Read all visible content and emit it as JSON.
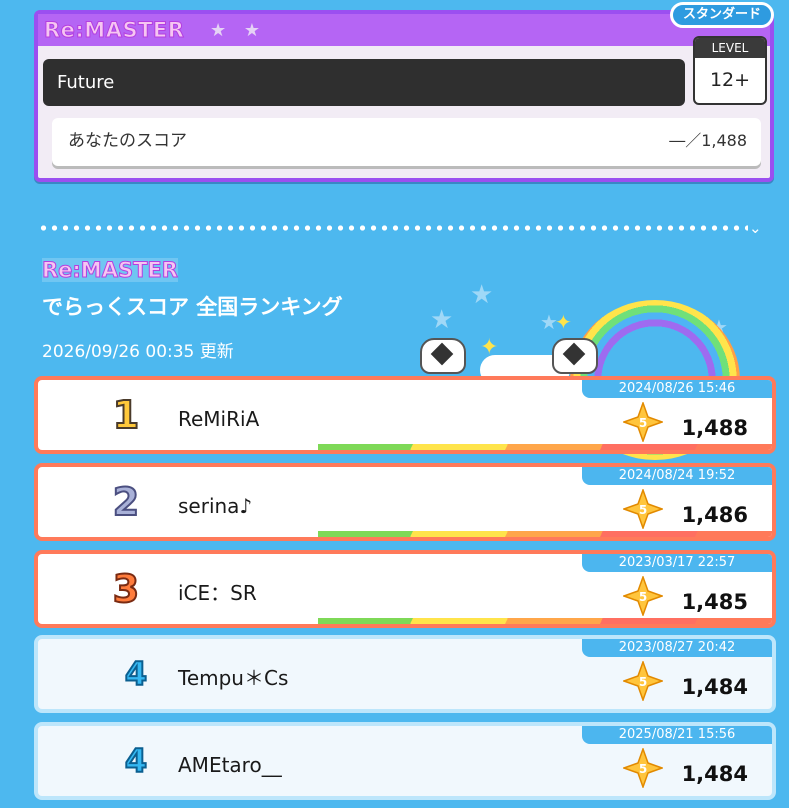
{
  "song": {
    "difficulty": "Re:MASTER",
    "stars": "★ ★",
    "chart_type": "スタンダード",
    "title": "Future",
    "level_label": "LEVEL",
    "level": "12+",
    "your_score_label": "あなたのスコア",
    "your_score": "―／1,488"
  },
  "ranking": {
    "difficulty": "Re:MASTER",
    "title": "でらっくスコア 全国ランキング",
    "updated": "2026/09/26 00:35 更新",
    "entries": [
      {
        "rank": "1",
        "player": "ReMiRiA",
        "date": "2024/08/26 15:46",
        "badge": "5",
        "score": "1,488"
      },
      {
        "rank": "2",
        "player": "serina♪",
        "date": "2024/08/24 19:52",
        "badge": "5",
        "score": "1,486"
      },
      {
        "rank": "3",
        "player": "iCE：SR",
        "date": "2023/03/17 22:57",
        "badge": "5",
        "score": "1,485"
      },
      {
        "rank": "4",
        "player": "Tempu＊Cs",
        "date": "2023/08/27 20:42",
        "badge": "5",
        "score": "1,484"
      },
      {
        "rank": "4",
        "player": "AMEtaro__",
        "date": "2025/08/21 15:56",
        "badge": "5",
        "score": "1,484"
      }
    ]
  },
  "colors": {
    "background": "#4db8ef",
    "remaster_purple": "#b565f4",
    "top_rank_border": "#ff7a5a",
    "date_tab": "#4cb6ef"
  }
}
